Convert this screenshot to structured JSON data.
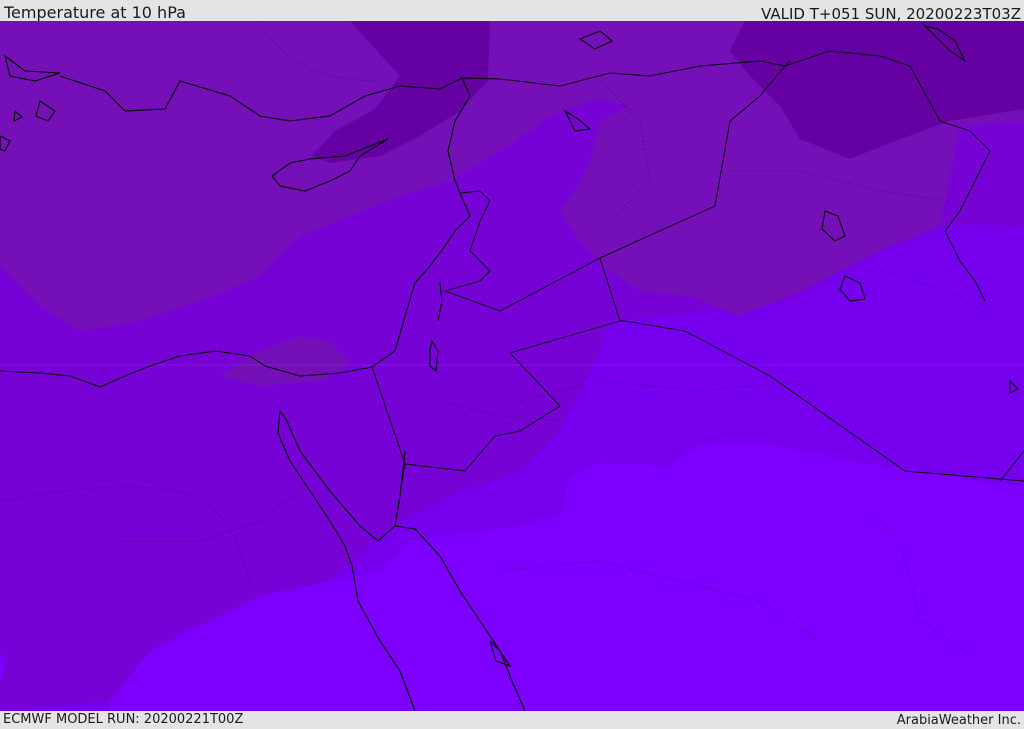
{
  "header": {
    "title": "Temperature at 10 hPa",
    "valid": "VALID T+051 SUN, 20200223T03Z"
  },
  "footer": {
    "model_run": "ECMWF MODEL RUN: 20200221T00Z",
    "credit": "ArabiaWeather Inc."
  },
  "map": {
    "colors": {
      "coldest": "#6500a3",
      "cold": "#7510b8",
      "mid": "#7702d6",
      "warm": "#7600ee",
      "warmest": "#7d00ff",
      "coastline": "#000000",
      "border": "#2a0050"
    }
  }
}
